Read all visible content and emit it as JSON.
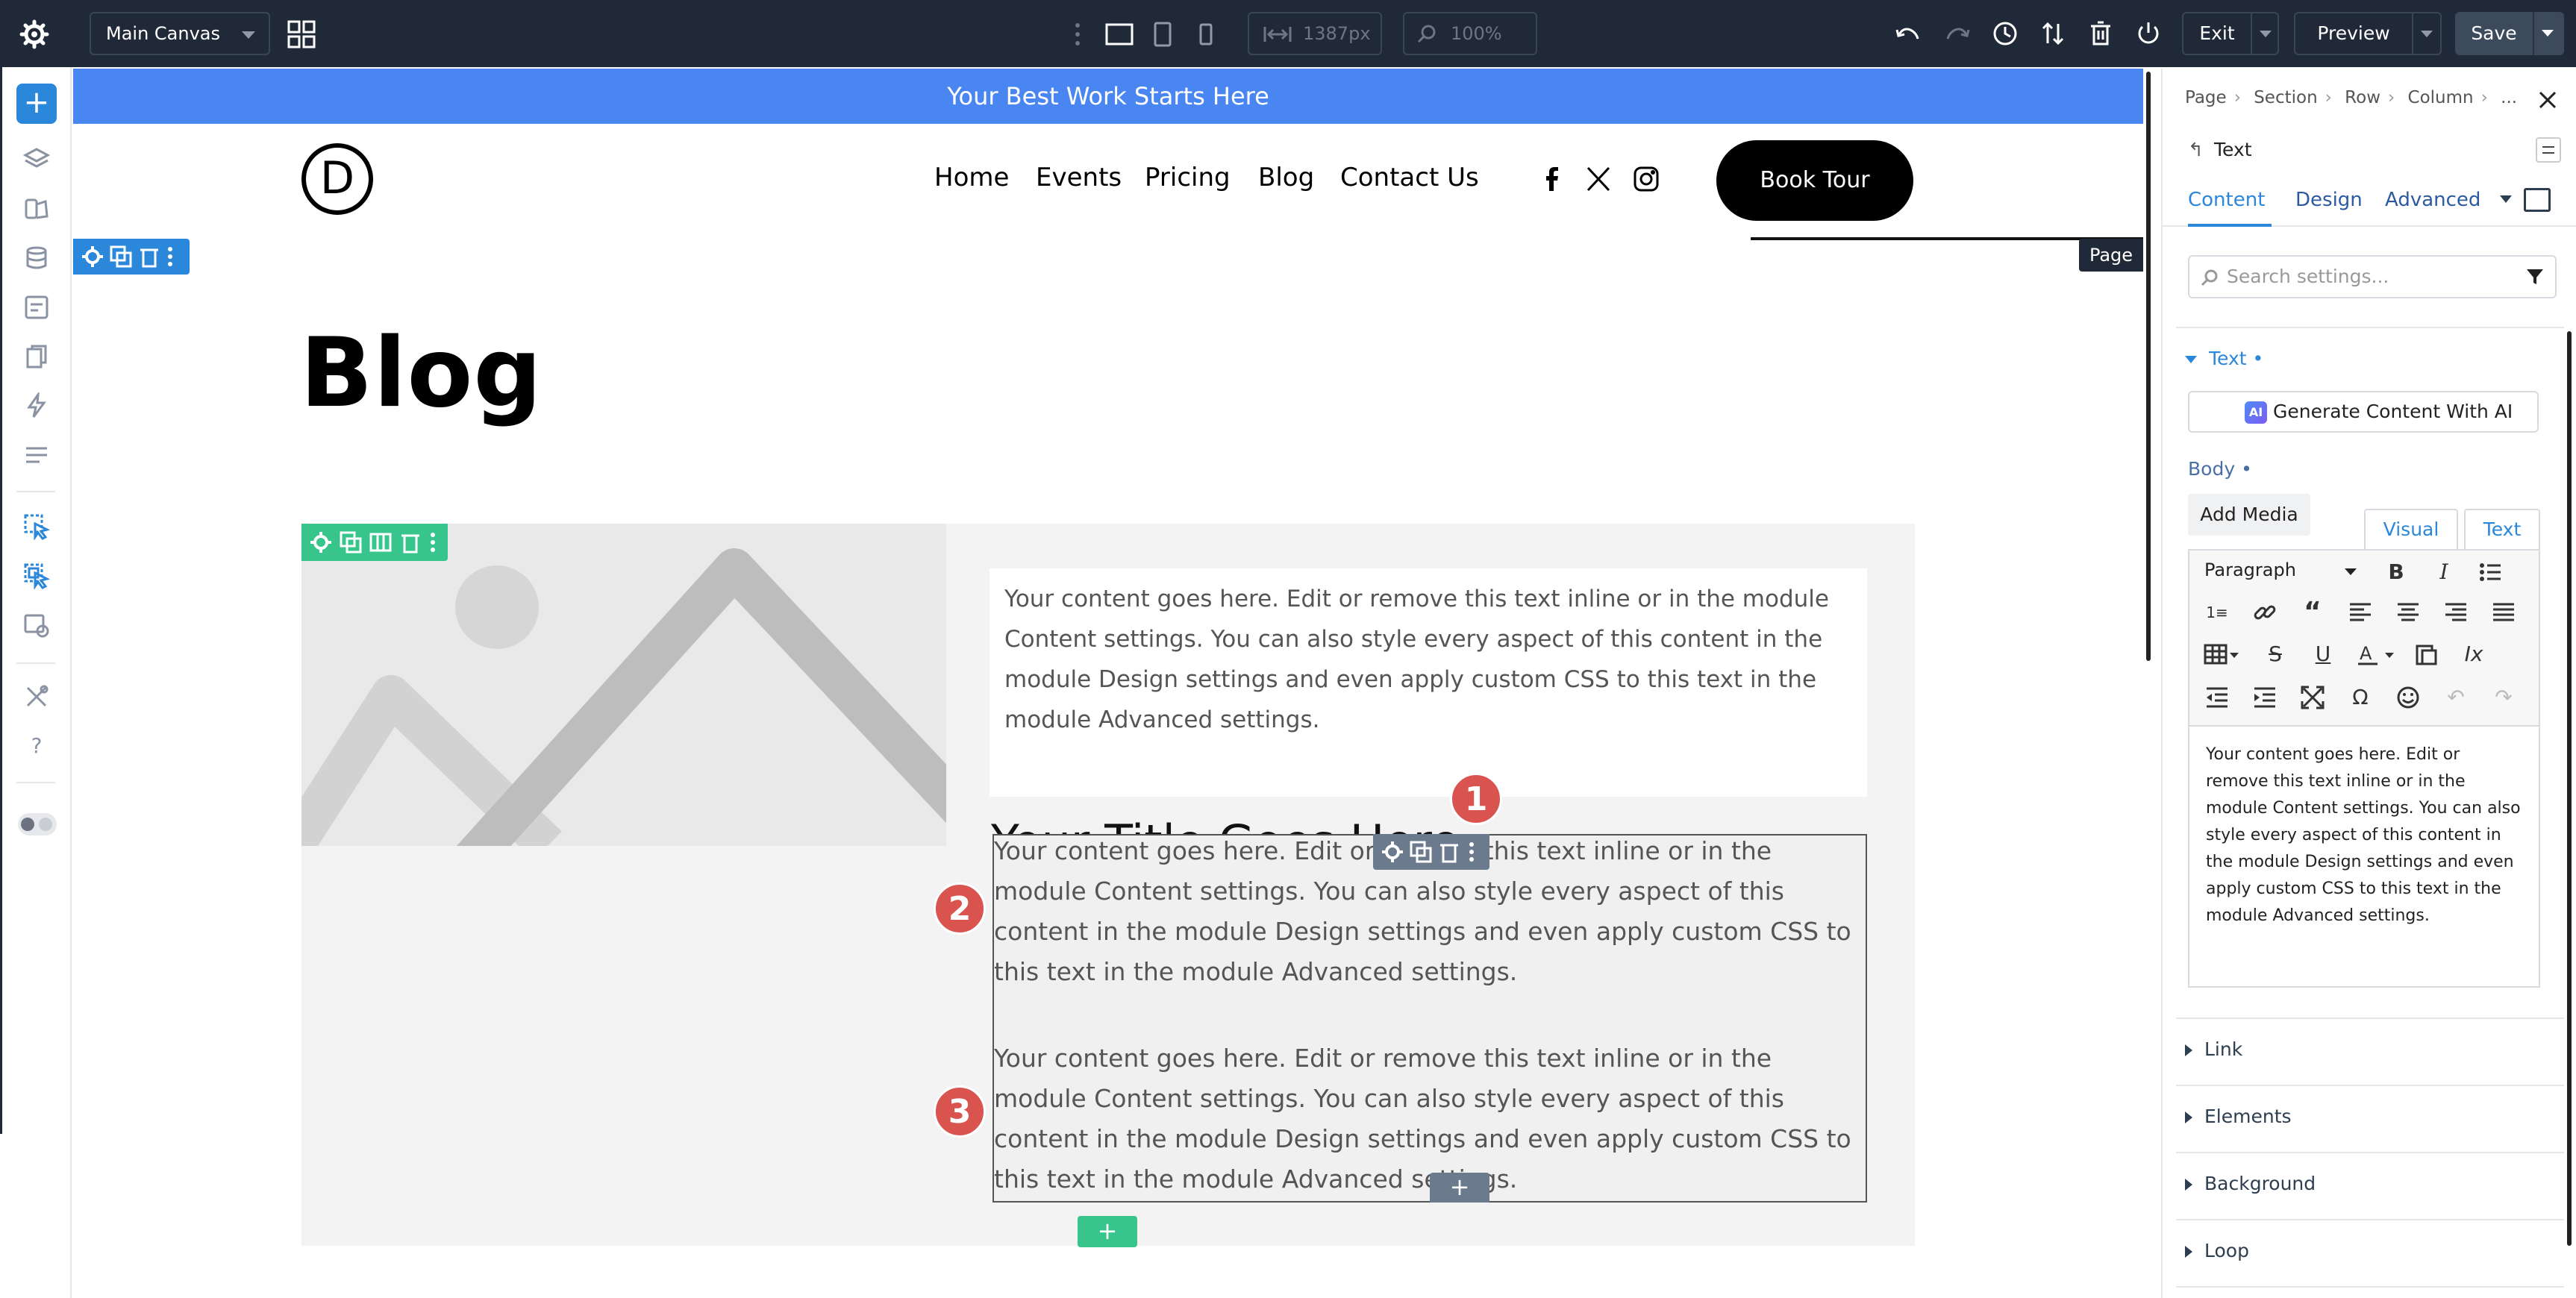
{
  "topbar": {
    "canvas_select": "Main Canvas",
    "width_value": "1387px",
    "zoom_value": "100%",
    "exit_label": "Exit",
    "preview_label": "Preview",
    "save_label": "Save",
    "colors": {
      "bg": "#202937",
      "accent": "#2b87da"
    }
  },
  "leftbar": {
    "icons": [
      "add-icon",
      "layers-icon",
      "paint-icon",
      "database-icon",
      "portability-icon",
      "pages-icon",
      "lightning-icon",
      "list-icon",
      "hand-select-icon",
      "multi-select-icon",
      "builder-settings-icon",
      "tools-icon",
      "help-icon",
      "mode-toggle-icon"
    ]
  },
  "site": {
    "announcement": "Your Best Work Starts Here",
    "logo_letter": "D",
    "nav": [
      "Home",
      "Events",
      "Pricing",
      "Blog",
      "Contact Us"
    ],
    "social_icons": [
      "facebook-icon",
      "x-icon",
      "instagram-icon"
    ],
    "cta": "Book Tour",
    "page_tag": "Page",
    "heading": "Blog",
    "intro_text": "Your content goes here. Edit or remove this text inline or in the module Content settings. You can also style every aspect of this content in the module Design settings and even apply custom CSS to this text in the module Advanced settings.",
    "post_title": "Your Title Goes Here",
    "paragraphs": [
      "Your content goes here. Edit or remove this text inline or in the module Content settings. You can also style every aspect of this content in the module Design settings and even apply custom CSS to this text in the module Advanced settings.",
      "Your content goes here. Edit or remove this text inline or in the module Content settings. You can also style every aspect of this content in the module Design settings and even apply custom CSS to this text in the module Advanced settings."
    ],
    "badges": [
      "1",
      "2",
      "3"
    ],
    "add_module": "+",
    "add_row": "+"
  },
  "panel": {
    "breadcrumb": [
      "Page",
      "Section",
      "Row",
      "Column",
      "..."
    ],
    "title": "Text",
    "back_glyph": "↰",
    "tabs": [
      "Content",
      "Design",
      "Advanced"
    ],
    "search_placeholder": "Search settings...",
    "text_section": "Text",
    "generate_ai": "Generate Content With AI",
    "ai_badge": "AI",
    "body_label": "Body",
    "add_media": "Add Media",
    "visual_tab": "Visual",
    "text_tab": "Text",
    "paragraph_select": "Paragraph",
    "editor_text": "Your content goes here. Edit or remove this text inline or in the module Content settings. You can also style every aspect of this content in the module Design settings and even apply custom CSS to this text in the module Advanced settings.",
    "collapsed_sections": [
      "Link",
      "Elements",
      "Background",
      "Loop"
    ],
    "dot": "•"
  }
}
